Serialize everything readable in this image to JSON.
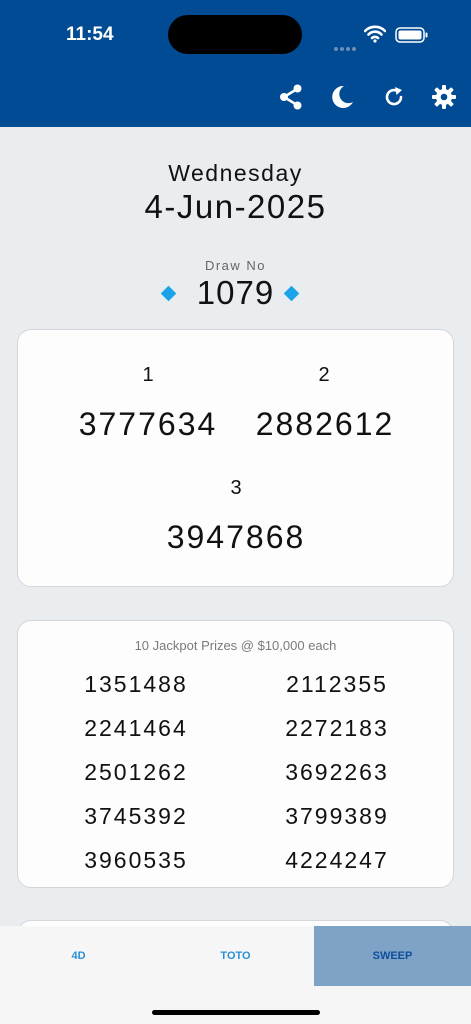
{
  "status_bar": {
    "time": "11:54"
  },
  "draw": {
    "day": "Wednesday",
    "date": "4-Jun-2025",
    "draw_label": "Draw No",
    "draw_number": "1079"
  },
  "top_prizes": [
    {
      "rank": "1",
      "number": "3777634"
    },
    {
      "rank": "2",
      "number": "2882612"
    },
    {
      "rank": "3",
      "number": "3947868"
    }
  ],
  "jackpot": {
    "label": "10 Jackpot Prizes @ $10,000 each",
    "numbers": [
      "1351488",
      "2112355",
      "2241464",
      "2272183",
      "2501262",
      "3692263",
      "3745392",
      "3799389",
      "3960535",
      "4224247"
    ]
  },
  "tabs": [
    {
      "label": "4D"
    },
    {
      "label": "TOTO"
    },
    {
      "label": "SWEEP",
      "selected": true
    }
  ],
  "colors": {
    "header": "#004b93",
    "accent_diamond": "#1aa3e8",
    "selected_tab_bg": "#7fa2c7",
    "tab_text": "#2a8fd6"
  },
  "icons": [
    "share-icon",
    "moon-icon",
    "refresh-icon",
    "gear-icon",
    "wifi-icon",
    "battery-icon"
  ]
}
